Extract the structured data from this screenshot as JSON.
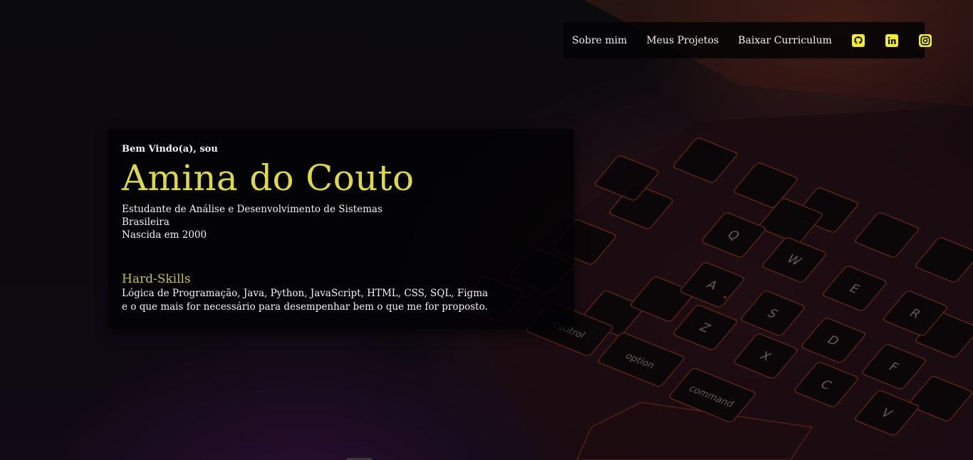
{
  "nav": {
    "items": [
      {
        "label": "Sobre mim"
      },
      {
        "label": "Meus Projetos"
      },
      {
        "label": "Baixar Curriculum"
      }
    ],
    "icons": [
      "github-icon",
      "linkedin-icon",
      "instagram-icon"
    ],
    "icon_color": "#f0ec36"
  },
  "hero": {
    "greeting": "Bem Vindo(a), sou",
    "name": "Amina do Couto",
    "info": [
      "Estudante de Análise e Desenvolvimento de Sistemas",
      "Brasileira",
      "Nascida em 2000"
    ],
    "skills_title": "Hard-Skills",
    "skills_lines": [
      "Lógica de Programação, Java, Python, JavaScript, HTML, CSS, SQL, Figma",
      "e o que mais for necessário para desempenhar bem o que me for proposto."
    ]
  },
  "background": {
    "keys": [
      "Q",
      "W",
      "E",
      "R",
      "A",
      "S",
      "D",
      "F",
      "Z",
      "X",
      "C",
      "V",
      "control",
      "option",
      "command"
    ],
    "accent": "#dcd84a"
  }
}
